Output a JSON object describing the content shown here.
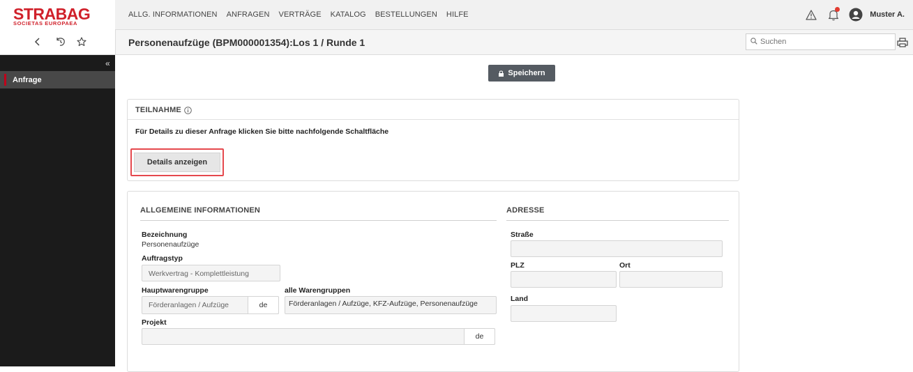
{
  "app": {
    "logo_text": "STRABAG",
    "logo_subtext": "SOCIETAS EUROPAEA",
    "brand_color": "#d0202a"
  },
  "nav": {
    "items": [
      "ALLG. INFORMATIONEN",
      "ANFRAGEN",
      "VERTRÄGE",
      "KATALOG",
      "BESTELLUNGEN",
      "HILFE"
    ],
    "user_name": "Muster A."
  },
  "header": {
    "title": "Personenaufzüge (BPM000001354):Los 1 / Runde 1",
    "search_placeholder": "Suchen"
  },
  "sidebar": {
    "items": [
      {
        "label": "Anfrage"
      }
    ]
  },
  "toolbar": {
    "save_label": "Speichern"
  },
  "teilnahme": {
    "title": "TEILNAHME",
    "text": "Für Details zu dieser Anfrage klicken Sie bitte nachfolgende Schaltfläche",
    "details_button": "Details anzeigen"
  },
  "allgemein": {
    "title": "ALLGEMEINE INFORMATIONEN",
    "bezeichnung_label": "Bezeichnung",
    "bezeichnung_value": "Personenaufzüge",
    "auftragstyp_label": "Auftragstyp",
    "auftragstyp_value": "Werkvertrag - Komplettleistung",
    "hauptwarengruppe_label": "Hauptwarengruppe",
    "hauptwarengruppe_value": "Förderanlagen / Aufzüge",
    "hauptwarengruppe_lang": "de",
    "alle_warengruppen_label": "alle Warengruppen",
    "alle_warengruppen_value": "Förderanlagen / Aufzüge, KFZ-Aufzüge, Personenaufzüge",
    "projekt_label": "Projekt",
    "projekt_value": "",
    "projekt_lang": "de"
  },
  "adresse": {
    "title": "ADRESSE",
    "strasse_label": "Straße",
    "strasse_value": "",
    "plz_label": "PLZ",
    "plz_value": "",
    "ort_label": "Ort",
    "ort_value": "",
    "land_label": "Land",
    "land_value": ""
  }
}
